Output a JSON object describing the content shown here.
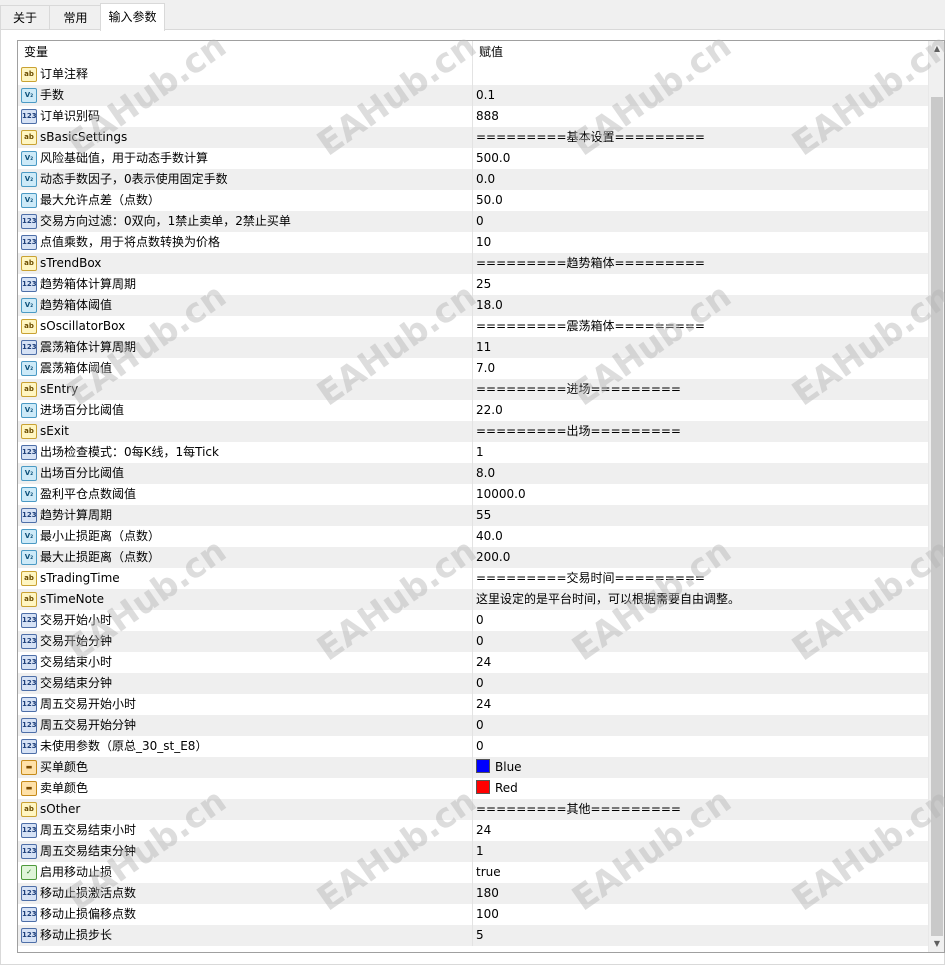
{
  "tabs": [
    "关于",
    "常用",
    "输入参数"
  ],
  "columns": {
    "variable": "变量",
    "value": "赋值"
  },
  "watermark": "EAHub.cn",
  "parameters": [
    {
      "type": "str",
      "name": "订单注释",
      "value": ""
    },
    {
      "type": "dbl",
      "name": "手数",
      "value": "0.1"
    },
    {
      "type": "int",
      "name": "订单识别码",
      "value": "888"
    },
    {
      "type": "str",
      "name": "sBasicSettings",
      "value": "=========基本设置========="
    },
    {
      "type": "dbl",
      "name": "风险基础值，用于动态手数计算",
      "value": "500.0"
    },
    {
      "type": "dbl",
      "name": "动态手数因子，0表示使用固定手数",
      "value": "0.0"
    },
    {
      "type": "dbl",
      "name": "最大允许点差（点数）",
      "value": "50.0"
    },
    {
      "type": "int",
      "name": "交易方向过滤：0双向，1禁止卖单，2禁止买单",
      "value": "0"
    },
    {
      "type": "int",
      "name": "点值乘数，用于将点数转换为价格",
      "value": "10"
    },
    {
      "type": "str",
      "name": "sTrendBox",
      "value": "=========趋势箱体========="
    },
    {
      "type": "int",
      "name": "趋势箱体计算周期",
      "value": "25"
    },
    {
      "type": "dbl",
      "name": "趋势箱体阈值",
      "value": "18.0"
    },
    {
      "type": "str",
      "name": "sOscillatorBox",
      "value": "=========震荡箱体========="
    },
    {
      "type": "int",
      "name": "震荡箱体计算周期",
      "value": "11"
    },
    {
      "type": "dbl",
      "name": "震荡箱体阈值",
      "value": "7.0"
    },
    {
      "type": "str",
      "name": "sEntry",
      "value": "=========进场========="
    },
    {
      "type": "dbl",
      "name": "进场百分比阈值",
      "value": "22.0"
    },
    {
      "type": "str",
      "name": "sExit",
      "value": "=========出场========="
    },
    {
      "type": "int",
      "name": "出场检查模式：0每K线，1每Tick",
      "value": "1"
    },
    {
      "type": "dbl",
      "name": "出场百分比阈值",
      "value": "8.0"
    },
    {
      "type": "dbl",
      "name": "盈利平仓点数阈值",
      "value": "10000.0"
    },
    {
      "type": "int",
      "name": "趋势计算周期",
      "value": "55"
    },
    {
      "type": "dbl",
      "name": "最小止损距离（点数）",
      "value": "40.0"
    },
    {
      "type": "dbl",
      "name": "最大止损距离（点数）",
      "value": "200.0"
    },
    {
      "type": "str",
      "name": "sTradingTime",
      "value": "=========交易时间========="
    },
    {
      "type": "str",
      "name": "sTimeNote",
      "value": "这里设定的是平台时间，可以根据需要自由调整。"
    },
    {
      "type": "int",
      "name": "交易开始小时",
      "value": "0"
    },
    {
      "type": "int",
      "name": "交易开始分钟",
      "value": "0"
    },
    {
      "type": "int",
      "name": "交易结束小时",
      "value": "24"
    },
    {
      "type": "int",
      "name": "交易结束分钟",
      "value": "0"
    },
    {
      "type": "int",
      "name": "周五交易开始小时",
      "value": "24"
    },
    {
      "type": "int",
      "name": "周五交易开始分钟",
      "value": "0"
    },
    {
      "type": "int",
      "name": "未使用参数（原总_30_st_E8）",
      "value": "0"
    },
    {
      "type": "clr",
      "name": "买单颜色",
      "value": "Blue",
      "color": "#0000ff"
    },
    {
      "type": "clr",
      "name": "卖单颜色",
      "value": "Red",
      "color": "#ff0000"
    },
    {
      "type": "str",
      "name": "sOther",
      "value": "=========其他========="
    },
    {
      "type": "int",
      "name": "周五交易结束小时",
      "value": "24"
    },
    {
      "type": "int",
      "name": "周五交易结束分钟",
      "value": "1"
    },
    {
      "type": "bool",
      "name": "启用移动止损",
      "value": "true"
    },
    {
      "type": "int",
      "name": "移动止损激活点数",
      "value": "180"
    },
    {
      "type": "int",
      "name": "移动止损偏移点数",
      "value": "100"
    },
    {
      "type": "int",
      "name": "移动止损步长",
      "value": "5"
    }
  ],
  "icons": {
    "str": "ab",
    "dbl": "V₂",
    "int": "123",
    "clr": "▬",
    "bool": "✓"
  }
}
